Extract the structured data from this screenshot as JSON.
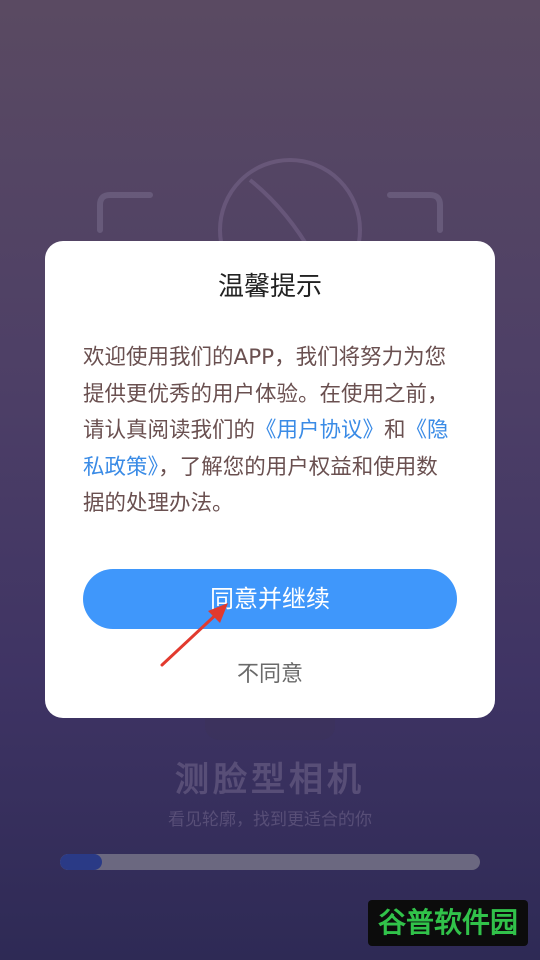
{
  "background": {
    "app_title": "测脸型相机",
    "app_subtitle": "看见轮廓，找到更适合的你",
    "progress": 0.1
  },
  "dialog": {
    "title": "温馨提示",
    "body_part1": "欢迎使用我们的APP，我们将努力为您提供更优秀的用户体验。在使用之前，请认真阅读我们的",
    "link_user_agreement": "《用户协议》",
    "body_and": "和",
    "link_privacy_policy": "《隐私政策》",
    "body_part2": "，了解您的用户权益和使用数据的处理办法。",
    "agree_label": "同意并继续",
    "disagree_label": "不同意"
  },
  "watermark": {
    "text": "谷普软件园"
  },
  "colors": {
    "primary_button": "#3f97fb",
    "link": "#3a8be6",
    "dialog_bg": "#ffffff"
  }
}
